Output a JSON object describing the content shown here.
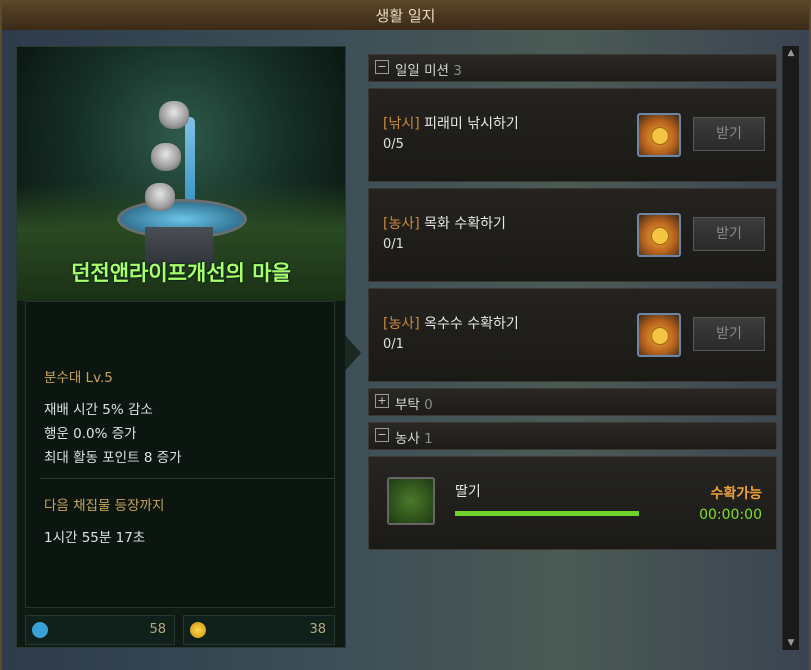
{
  "window": {
    "title": "생활 일지"
  },
  "village": {
    "name": "던전앤라이프개선의 마을",
    "facility": "분수대 Lv.5",
    "effects": [
      "재배 시간 5% 감소",
      "행운 0.0% 증가",
      "최대 활동 포인트 8 증가"
    ],
    "next_label": "다음 채집물 등장까지",
    "next_time": "1시간 55분 17초"
  },
  "stats": {
    "paw_icon": "paw-icon",
    "paw_value": "58",
    "coin_icon": "coin-icon",
    "coin_value": "38"
  },
  "sections": {
    "daily": {
      "toggle": "−",
      "label": "일일 미션",
      "count": "3"
    },
    "request": {
      "toggle": "+",
      "label": "부탁",
      "count": "0"
    },
    "farming": {
      "toggle": "−",
      "label": "농사",
      "count": "1"
    }
  },
  "missions": [
    {
      "category": "[낚시]",
      "name": "피래미 낚시하기",
      "progress": "0/5",
      "claim": "받기"
    },
    {
      "category": "[농사]",
      "name": "목화 수확하기",
      "progress": "0/1",
      "claim": "받기"
    },
    {
      "category": "[농사]",
      "name": "옥수수 수확하기",
      "progress": "0/1",
      "claim": "받기"
    }
  ],
  "crop": {
    "name": "딸기",
    "status": "수확가능",
    "timer": "00:00:00",
    "progress": 1.0
  },
  "colors": {
    "village_name": "#a8ff6a",
    "category": "#c98a3e",
    "ready": "#f0a13c",
    "timer": "#7ee02c",
    "bar": "#6fd12a"
  }
}
